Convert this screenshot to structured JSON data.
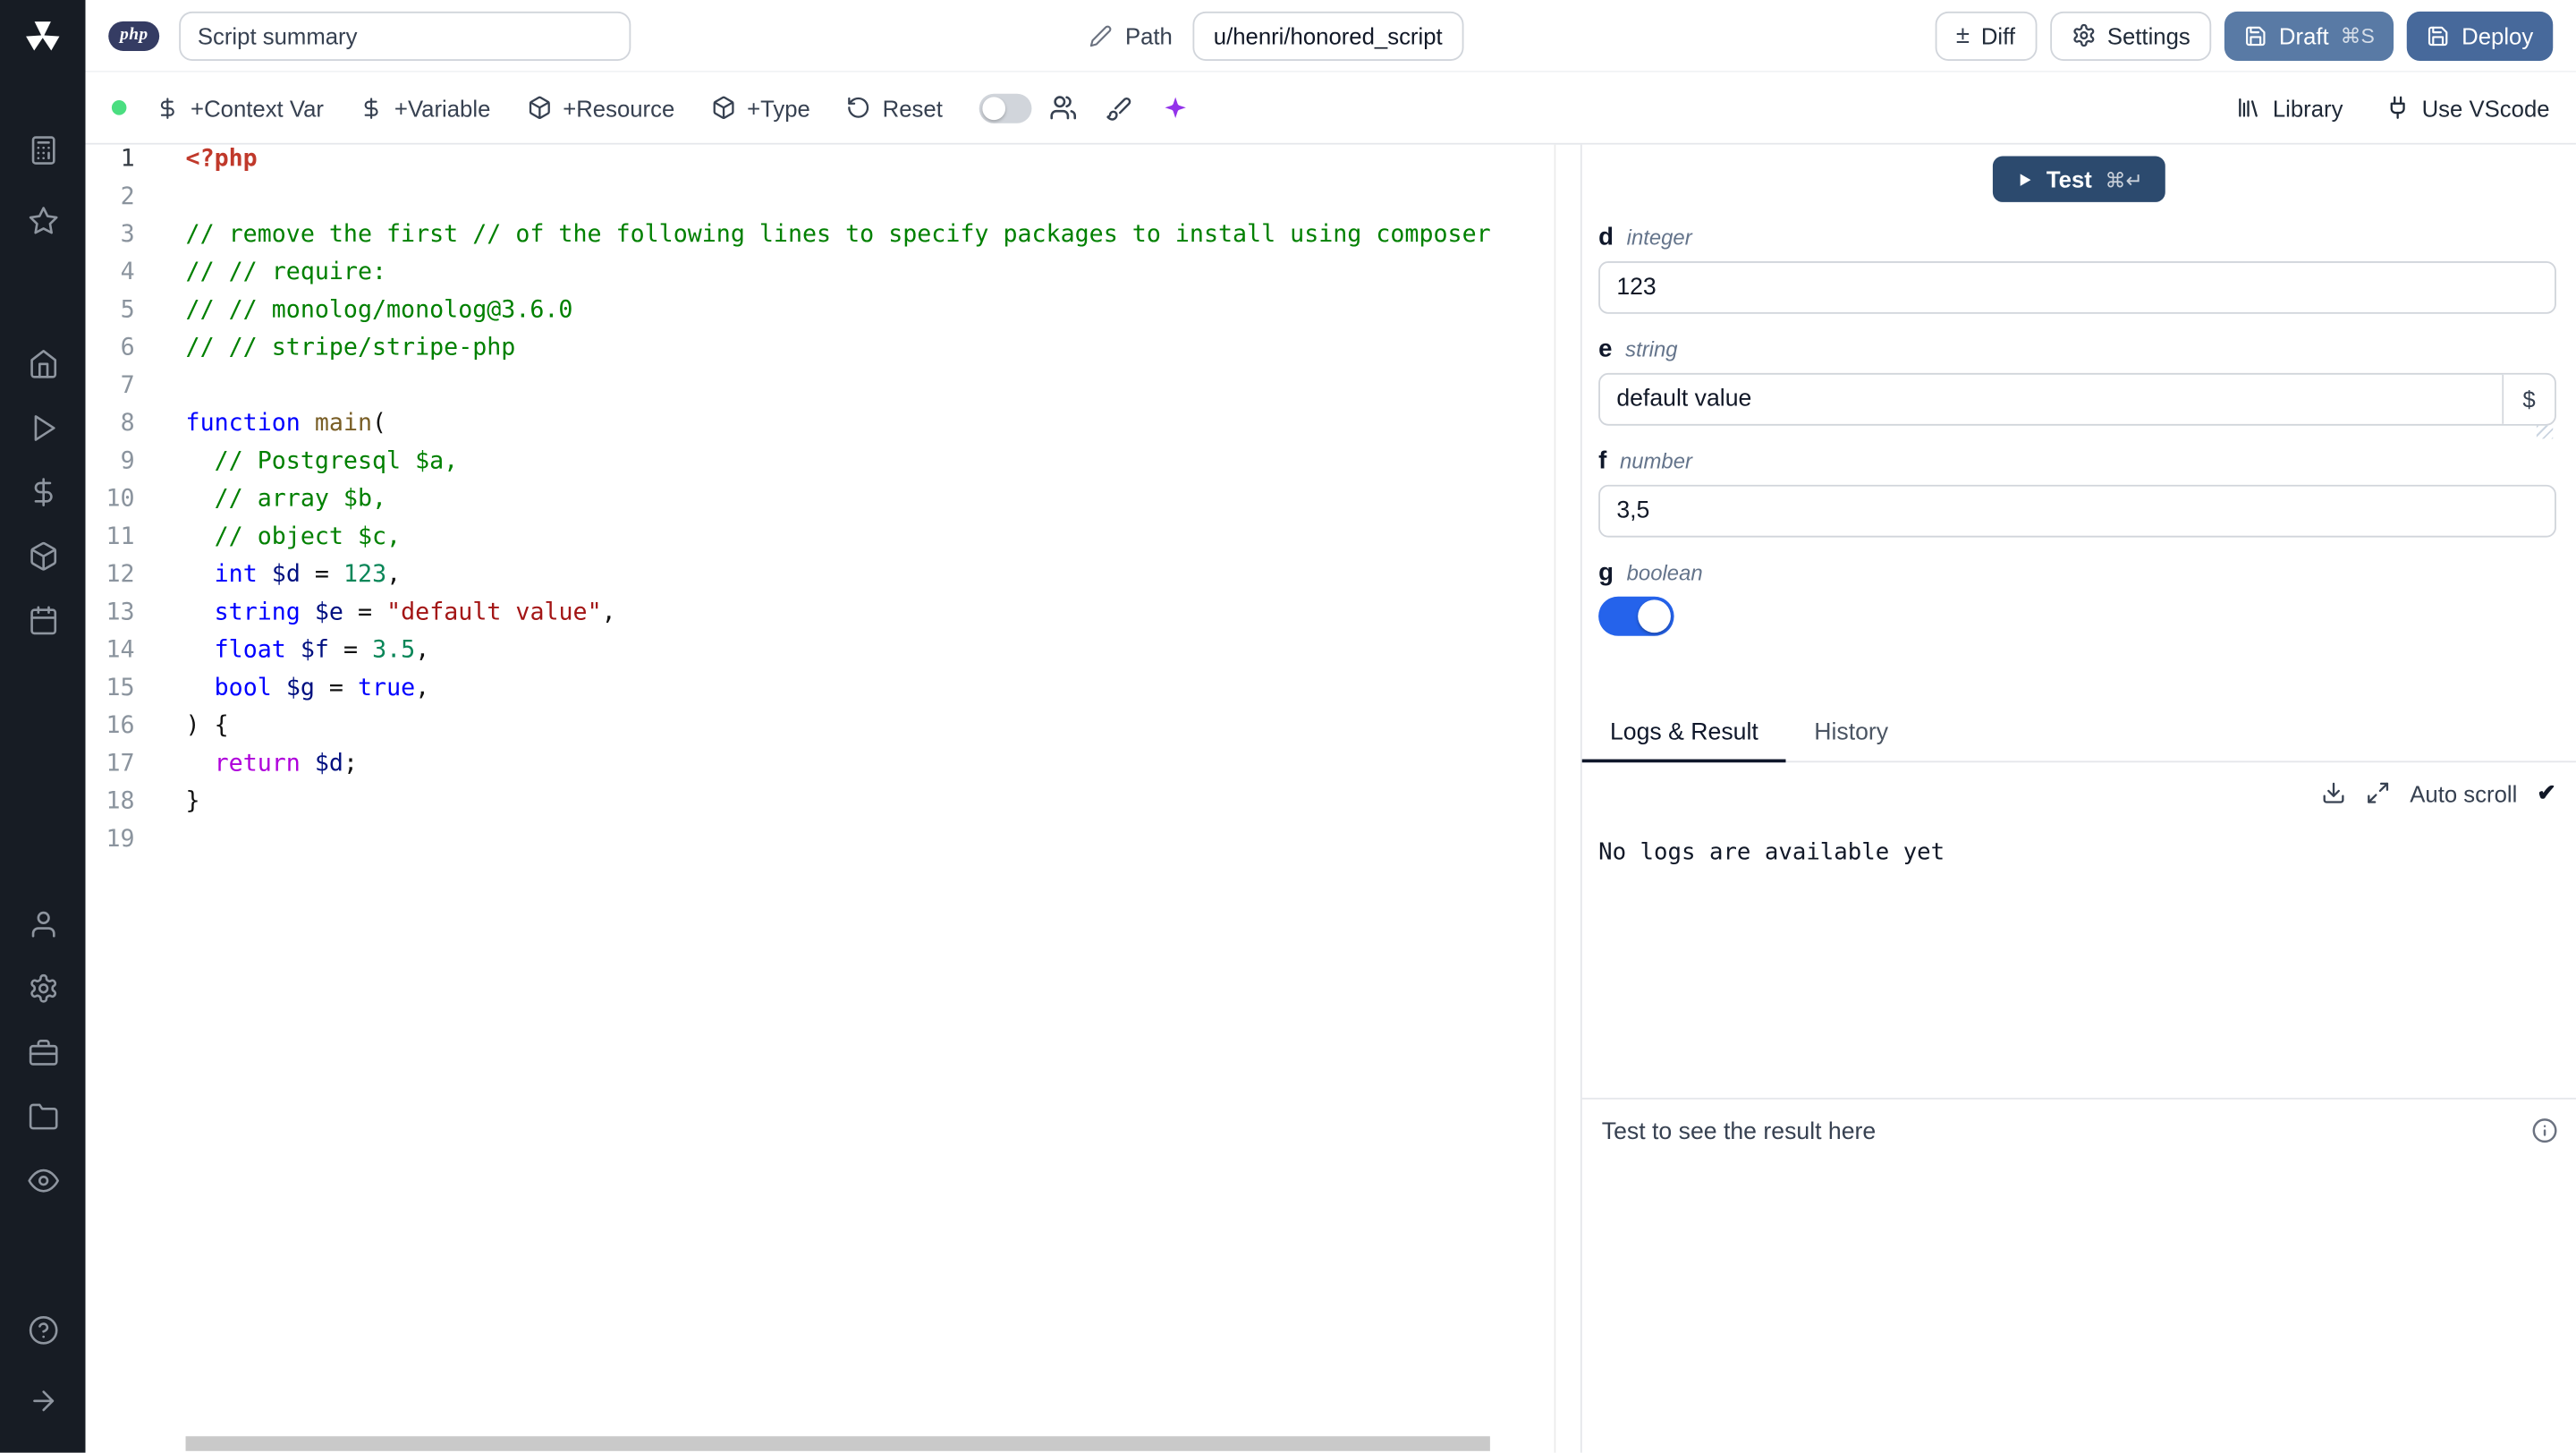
{
  "colors": {
    "sidebar_bg": "#171c24",
    "status_green": "#4ade80",
    "accent_blue": "#2563eb",
    "draft_bg": "#597aa5",
    "deploy_bg": "#47699b",
    "test_bg": "#2c4a6e",
    "ai_purple": "#9333ea",
    "code_comment": "#008000",
    "code_keyword": "#0000ff",
    "code_variable": "#001080",
    "code_number": "#098658",
    "code_string": "#a31515",
    "code_meta": "#c0392b",
    "code_control": "#af00db",
    "code_function": "#795e26"
  },
  "header": {
    "language_badge": "php",
    "summary_value": "Script summary",
    "path_label": "Path",
    "path_value": "u/henri/honored_script",
    "diff_label": "Diff",
    "settings_label": "Settings",
    "draft_label": "Draft",
    "draft_shortcut": "⌘S",
    "deploy_label": "Deploy"
  },
  "toolbar": {
    "add_context_var": "+Context Var",
    "add_variable": "+Variable",
    "add_resource": "+Resource",
    "add_type": "+Type",
    "reset_label": "Reset",
    "library_label": "Library",
    "use_vscode_label": "Use VScode"
  },
  "editor": {
    "language": "php",
    "lines": [
      {
        "n": "1",
        "tokens": [
          [
            "meta",
            "<?php"
          ]
        ]
      },
      {
        "n": "2",
        "tokens": []
      },
      {
        "n": "3",
        "tokens": [
          [
            "comment",
            "// remove the first // of the following lines to specify packages to install using composer"
          ]
        ]
      },
      {
        "n": "4",
        "tokens": [
          [
            "comment",
            "// // require:"
          ]
        ]
      },
      {
        "n": "5",
        "tokens": [
          [
            "comment",
            "// // monolog/monolog@3.6.0"
          ]
        ]
      },
      {
        "n": "6",
        "tokens": [
          [
            "comment",
            "// // stripe/stripe-php"
          ]
        ]
      },
      {
        "n": "7",
        "tokens": []
      },
      {
        "n": "8",
        "tokens": [
          [
            "kw",
            "function"
          ],
          [
            "plain",
            " "
          ],
          [
            "fn",
            "main"
          ],
          [
            "plain",
            "("
          ]
        ]
      },
      {
        "n": "9",
        "tokens": [
          [
            "plain",
            "  "
          ],
          [
            "comment",
            "// Postgresql $a,"
          ]
        ]
      },
      {
        "n": "10",
        "tokens": [
          [
            "plain",
            "  "
          ],
          [
            "comment",
            "// array $b,"
          ]
        ]
      },
      {
        "n": "11",
        "tokens": [
          [
            "plain",
            "  "
          ],
          [
            "comment",
            "// object $c,"
          ]
        ]
      },
      {
        "n": "12",
        "tokens": [
          [
            "plain",
            "  "
          ],
          [
            "type",
            "int"
          ],
          [
            "plain",
            " "
          ],
          [
            "var",
            "$d"
          ],
          [
            "plain",
            " = "
          ],
          [
            "num",
            "123"
          ],
          [
            "plain",
            ","
          ]
        ]
      },
      {
        "n": "13",
        "tokens": [
          [
            "plain",
            "  "
          ],
          [
            "type",
            "string"
          ],
          [
            "plain",
            " "
          ],
          [
            "var",
            "$e"
          ],
          [
            "plain",
            " = "
          ],
          [
            "str",
            "\"default value\""
          ],
          [
            "plain",
            ","
          ]
        ]
      },
      {
        "n": "14",
        "tokens": [
          [
            "plain",
            "  "
          ],
          [
            "type",
            "float"
          ],
          [
            "plain",
            " "
          ],
          [
            "var",
            "$f"
          ],
          [
            "plain",
            " = "
          ],
          [
            "num",
            "3.5"
          ],
          [
            "plain",
            ","
          ]
        ]
      },
      {
        "n": "15",
        "tokens": [
          [
            "plain",
            "  "
          ],
          [
            "type",
            "bool"
          ],
          [
            "plain",
            " "
          ],
          [
            "var",
            "$g"
          ],
          [
            "plain",
            " = "
          ],
          [
            "kw",
            "true"
          ],
          [
            "plain",
            ","
          ]
        ]
      },
      {
        "n": "16",
        "tokens": [
          [
            "plain",
            ") {"
          ]
        ]
      },
      {
        "n": "17",
        "tokens": [
          [
            "plain",
            "  "
          ],
          [
            "ctrl",
            "return"
          ],
          [
            "plain",
            " "
          ],
          [
            "var",
            "$d"
          ],
          [
            "plain",
            ";"
          ]
        ]
      },
      {
        "n": "18",
        "tokens": [
          [
            "plain",
            "}"
          ]
        ]
      },
      {
        "n": "19",
        "tokens": []
      }
    ]
  },
  "preview": {
    "test_label": "Test",
    "test_shortcut": "⌘↵",
    "fields": [
      {
        "name": "d",
        "type": "integer",
        "value": "123",
        "control": "input"
      },
      {
        "name": "e",
        "type": "string",
        "value": "default value",
        "control": "input-with-dollar"
      },
      {
        "name": "f",
        "type": "number",
        "value": "3,5",
        "control": "input"
      },
      {
        "name": "g",
        "type": "boolean",
        "value": "on",
        "control": "toggle"
      }
    ],
    "tabs": [
      "Logs & Result",
      "History"
    ],
    "active_tab": "Logs & Result",
    "auto_scroll_label": "Auto scroll",
    "logs_empty": "No logs are available yet",
    "result_placeholder": "Test to see the result here"
  }
}
